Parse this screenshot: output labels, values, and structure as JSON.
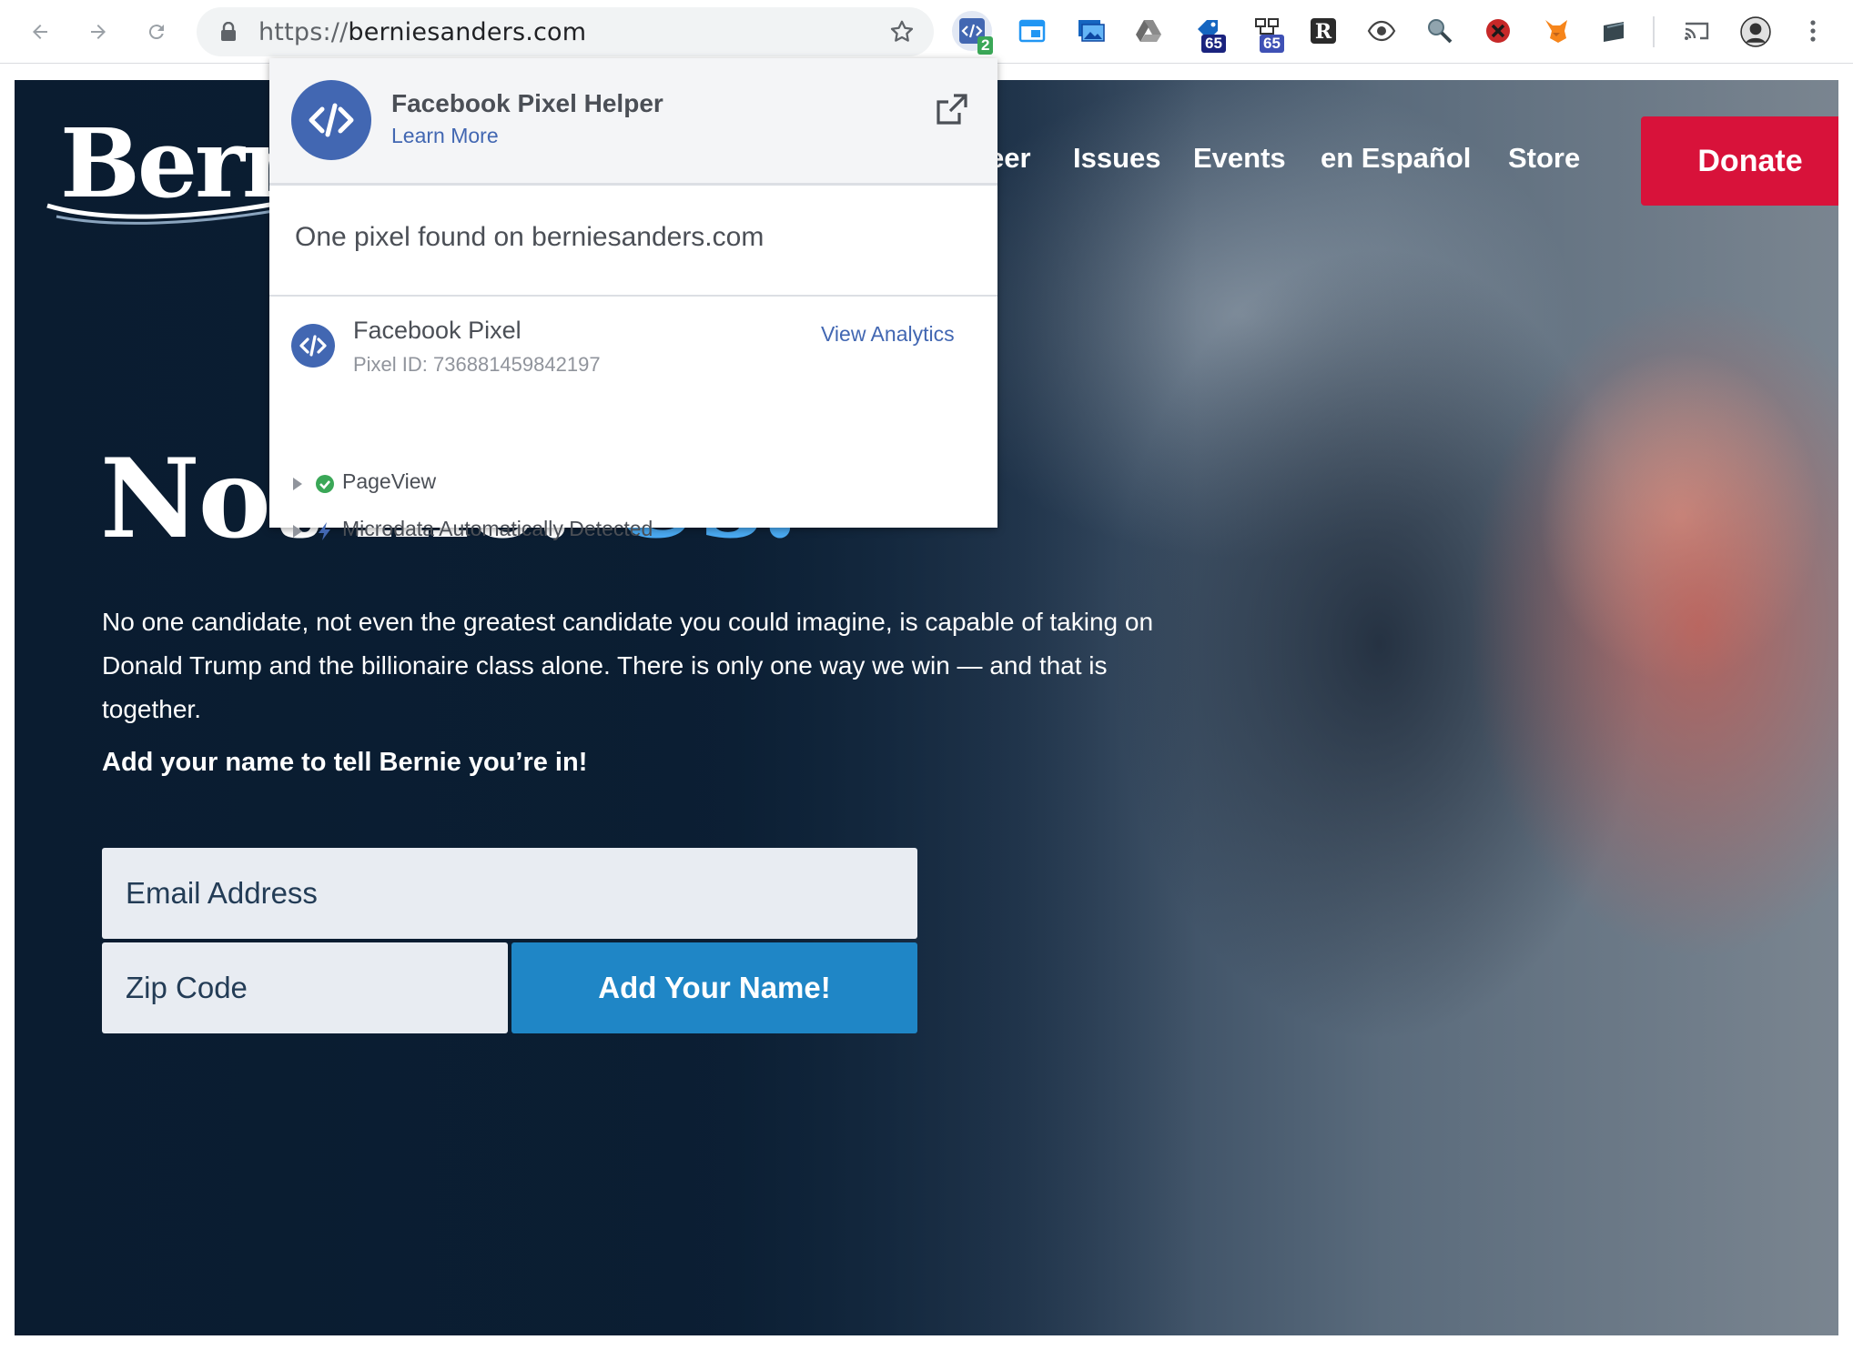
{
  "browser": {
    "url_scheme": "https://",
    "url_host": "berniesanders.com",
    "extensions": [
      {
        "icon": "facebook-pixel-helper-icon",
        "badge": "2"
      },
      {
        "icon": "window-icon"
      },
      {
        "icon": "screenshot-icon"
      },
      {
        "icon": "drive-icon"
      },
      {
        "icon": "tag-icon",
        "badge": "65"
      },
      {
        "icon": "network-icon",
        "badge": "65"
      },
      {
        "icon": "r-icon",
        "letter": "R"
      },
      {
        "icon": "eye-icon"
      },
      {
        "icon": "inspector-icon"
      },
      {
        "icon": "blocker-icon"
      },
      {
        "icon": "fox-icon"
      },
      {
        "icon": "folder-icon"
      },
      {
        "icon": "cast-icon"
      },
      {
        "icon": "avatar"
      },
      {
        "icon": "more-icon"
      }
    ]
  },
  "site": {
    "logo": "Bern",
    "nav": [
      "eer",
      "Issues",
      "Events",
      "en Español",
      "Store"
    ],
    "donate": "Donate",
    "headline_part1": "Not me.",
    "headline_part2": "Us.",
    "body": "No one candidate, not even the greatest candidate you could imagine, is capable of taking on Donald Trump and the billionaire class alone. There is only one way we win — and that is together.",
    "cta": "Add your name to tell Bernie you’re in!",
    "email_placeholder": "Email Address",
    "zip_placeholder": "Zip Code",
    "submit": "Add Your Name!"
  },
  "popup": {
    "title": "Facebook Pixel Helper",
    "learn_more": "Learn More",
    "summary": "One pixel found on berniesanders.com",
    "pixel_name": "Facebook Pixel",
    "pixel_id": "Pixel ID: 736881459842197",
    "view_analytics": "View Analytics",
    "events": [
      "PageView",
      "Microdata Automatically Detected"
    ]
  },
  "colors": {
    "donate": "#d8123a",
    "submit": "#1f86c6",
    "facebook_blue": "#4267b2",
    "headline_accent": "#4aaaf2",
    "hero_navy": "#0f2a44"
  }
}
